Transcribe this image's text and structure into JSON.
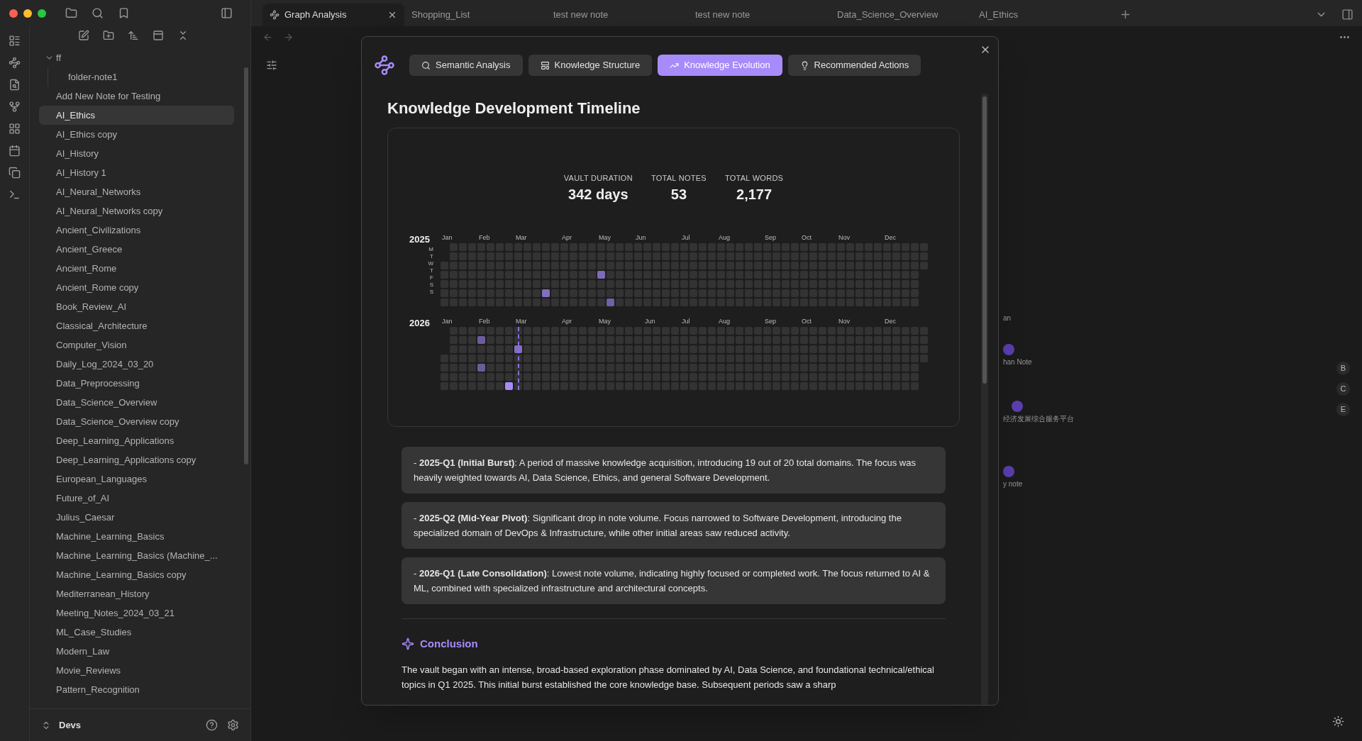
{
  "window_tabs": [
    {
      "label": "Graph Analysis",
      "selected": true
    },
    {
      "label": "Shopping_List",
      "selected": false
    },
    {
      "label": "test new note",
      "selected": false
    },
    {
      "label": "test new note",
      "selected": false
    },
    {
      "label": "Data_Science_Overview",
      "selected": false
    },
    {
      "label": "AI_Ethics",
      "selected": false
    }
  ],
  "file_explorer": {
    "items": [
      {
        "kind": "folder",
        "label": "ff",
        "expanded": true,
        "selected": false,
        "children": [
          {
            "label": "folder-note1",
            "selected": false
          }
        ]
      },
      {
        "kind": "note",
        "label": "Add New Note for Testing",
        "selected": false
      },
      {
        "kind": "note",
        "label": "AI_Ethics",
        "selected": true
      },
      {
        "kind": "note",
        "label": "AI_Ethics copy",
        "selected": false
      },
      {
        "kind": "note",
        "label": "AI_History",
        "selected": false
      },
      {
        "kind": "note",
        "label": "AI_History 1",
        "selected": false
      },
      {
        "kind": "note",
        "label": "AI_Neural_Networks",
        "selected": false
      },
      {
        "kind": "note",
        "label": "AI_Neural_Networks copy",
        "selected": false
      },
      {
        "kind": "note",
        "label": "Ancient_Civilizations",
        "selected": false
      },
      {
        "kind": "note",
        "label": "Ancient_Greece",
        "selected": false
      },
      {
        "kind": "note",
        "label": "Ancient_Rome",
        "selected": false
      },
      {
        "kind": "note",
        "label": "Ancient_Rome copy",
        "selected": false
      },
      {
        "kind": "note",
        "label": "Book_Review_AI",
        "selected": false
      },
      {
        "kind": "note",
        "label": "Classical_Architecture",
        "selected": false
      },
      {
        "kind": "note",
        "label": "Computer_Vision",
        "selected": false
      },
      {
        "kind": "note",
        "label": "Daily_Log_2024_03_20",
        "selected": false
      },
      {
        "kind": "note",
        "label": "Data_Preprocessing",
        "selected": false
      },
      {
        "kind": "note",
        "label": "Data_Science_Overview",
        "selected": false
      },
      {
        "kind": "note",
        "label": "Data_Science_Overview copy",
        "selected": false
      },
      {
        "kind": "note",
        "label": "Deep_Learning_Applications",
        "selected": false
      },
      {
        "kind": "note",
        "label": "Deep_Learning_Applications copy",
        "selected": false
      },
      {
        "kind": "note",
        "label": "European_Languages",
        "selected": false
      },
      {
        "kind": "note",
        "label": "Future_of_AI",
        "selected": false
      },
      {
        "kind": "note",
        "label": "Julius_Caesar",
        "selected": false
      },
      {
        "kind": "note",
        "label": "Machine_Learning_Basics",
        "selected": false
      },
      {
        "kind": "note",
        "label": "Machine_Learning_Basics (Machine_...",
        "selected": false
      },
      {
        "kind": "note",
        "label": "Machine_Learning_Basics copy",
        "selected": false
      },
      {
        "kind": "note",
        "label": "Mediterranean_History",
        "selected": false
      },
      {
        "kind": "note",
        "label": "Meeting_Notes_2024_03_21",
        "selected": false
      },
      {
        "kind": "note",
        "label": "ML_Case_Studies",
        "selected": false
      },
      {
        "kind": "note",
        "label": "Modern_Law",
        "selected": false
      },
      {
        "kind": "note",
        "label": "Movie_Reviews",
        "selected": false
      },
      {
        "kind": "note",
        "label": "Pattern_Recognition",
        "selected": false
      }
    ]
  },
  "vault": {
    "name": "Devs"
  },
  "graph": {
    "nodes": [
      {
        "kind": "label",
        "label": "an"
      },
      {
        "kind": "node",
        "label": "han Note"
      },
      {
        "kind": "node",
        "label": "经济发展综合服务平台"
      },
      {
        "kind": "node",
        "label": "y note"
      }
    ],
    "legend": [
      "B",
      "C",
      "E"
    ]
  },
  "modal": {
    "tabs": [
      {
        "kind": "search",
        "label": "Semantic Analysis",
        "selected": false
      },
      {
        "kind": "structure",
        "label": "Knowledge Structure",
        "selected": false
      },
      {
        "kind": "trend",
        "label": "Knowledge Evolution",
        "selected": true
      },
      {
        "kind": "idea",
        "label": "Recommended Actions",
        "selected": false
      }
    ],
    "title": "Knowledge Development Timeline",
    "stats": [
      {
        "label": "VAULT DURATION",
        "value": "342 days"
      },
      {
        "label": "TOTAL NOTES",
        "value": "53"
      },
      {
        "label": "TOTAL WORDS",
        "value": "2,177"
      }
    ],
    "heatmap": {
      "years": [
        {
          "label": "2025",
          "days": [
            "M",
            "T",
            "W",
            "T",
            "F",
            "S",
            "S"
          ],
          "months": [
            "Jan",
            "Feb",
            "Mar",
            "Apr",
            "May",
            "Jun",
            "Jul",
            "Aug",
            "Sep",
            "Oct",
            "Nov",
            "Dec"
          ]
        },
        {
          "label": "2026",
          "months": [
            "Jan",
            "Feb",
            "Mar",
            "Apr",
            "May",
            "Jun",
            "Jul",
            "Aug",
            "Sep",
            "Oct",
            "Nov",
            "Dec"
          ]
        }
      ]
    },
    "periods": [
      "- **2025-Q1 (Initial Burst)**: A period of massive knowledge acquisition, introducing 19 out of 20 total domains. The focus was heavily weighted towards AI, Data Science, Ethics, and general Software Development.",
      "- **2025-Q2 (Mid-Year Pivot)**: Significant drop in note volume. Focus narrowed to Software Development, introducing the specialized domain of DevOps & Infrastructure, while other initial areas saw reduced activity.",
      "- **2026-Q1 (Late Consolidation)**: Lowest note volume, indicating highly focused or completed work. The focus returned to AI & ML, combined with specialized infrastructure and architectural concepts."
    ],
    "conclusion": {
      "title": "Conclusion",
      "text": "The vault began with an intense, broad-based exploration phase dominated by AI, Data Science, and foundational technical/ethical topics in Q1 2025. This initial burst established the core knowledge base. Subsequent periods saw a sharp"
    }
  }
}
